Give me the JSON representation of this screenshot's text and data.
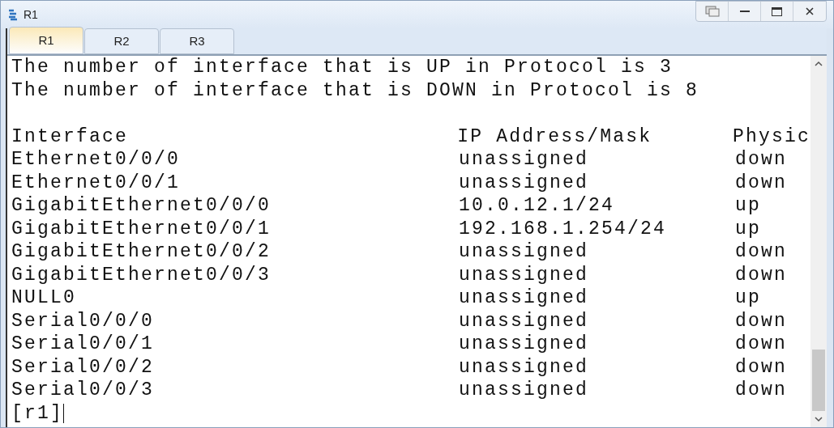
{
  "window": {
    "title": "R1"
  },
  "tabs": [
    {
      "label": "R1",
      "selected": true
    },
    {
      "label": "R2",
      "selected": false
    },
    {
      "label": "R3",
      "selected": false
    }
  ],
  "terminal": {
    "summary": [
      "The number of interface that is UP in Protocol is 3",
      "The number of interface that is DOWN in Protocol is 8"
    ],
    "columns": [
      "Interface",
      "IP Address/Mask",
      "Physic"
    ],
    "rows": [
      [
        "Ethernet0/0/0",
        "unassigned",
        "down"
      ],
      [
        "Ethernet0/0/1",
        "unassigned",
        "down"
      ],
      [
        "GigabitEthernet0/0/0",
        "10.0.12.1/24",
        "up"
      ],
      [
        "GigabitEthernet0/0/1",
        "192.168.1.254/24",
        "up"
      ],
      [
        "GigabitEthernet0/0/2",
        "unassigned",
        "down"
      ],
      [
        "GigabitEthernet0/0/3",
        "unassigned",
        "down"
      ],
      [
        "NULL0",
        "unassigned",
        "up"
      ],
      [
        "Serial0/0/0",
        "unassigned",
        "down"
      ],
      [
        "Serial0/0/1",
        "unassigned",
        "down"
      ],
      [
        "Serial0/0/2",
        "unassigned",
        "down"
      ],
      [
        "Serial0/0/3",
        "unassigned",
        "down"
      ]
    ],
    "prompt": "[r1]"
  }
}
